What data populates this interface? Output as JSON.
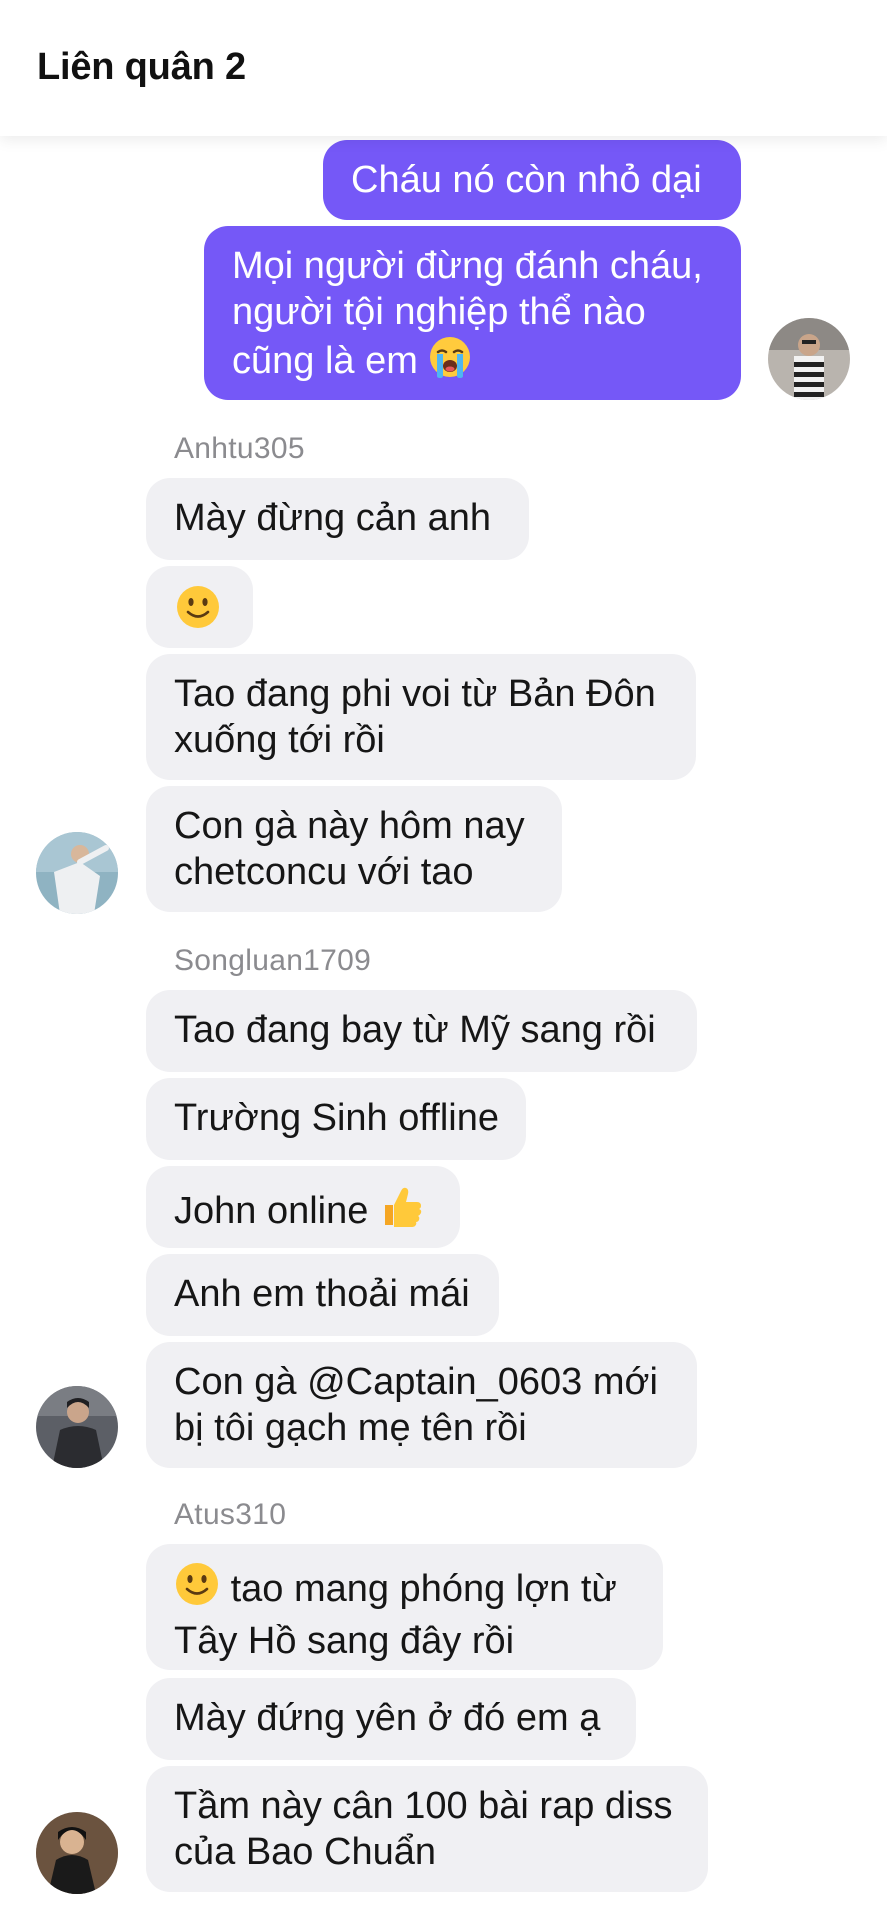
{
  "header": {
    "title": "Liên quân 2"
  },
  "messages": {
    "out_1": "Cháu nó còn nhỏ dại",
    "out_2_line1": "Mọi người đừng đánh cháu,",
    "out_2_line2": "người tội nghiệp thể nào",
    "out_2_line3": "cũng là em",
    "anhtu": {
      "sender": "Anhtu305",
      "m1": "Mày đừng cản anh",
      "m3_line1": "Tao đang phi voi từ Bản Đôn",
      "m3_line2": "xuống tới rồi",
      "m4_line1": "Con gà này hôm nay",
      "m4_line2": "chetconcu với tao"
    },
    "songluan": {
      "sender": "Songluan1709",
      "m1": "Tao đang bay từ Mỹ sang rồi",
      "m2": "Trường Sinh offline",
      "m3": "John online",
      "m4": "Anh em thoải mái",
      "m5_line1": "Con gà @Captain_0603 mới",
      "m5_line2": "bị tôi gạch mẹ tên rồi"
    },
    "atus": {
      "sender": "Atus310",
      "m1_line1": "tao mang phóng lợn từ",
      "m1_line2": "Tây Hồ sang đây rồi",
      "m2": "Mày đứng yên ở đó em ạ",
      "m3_line1": "Tầm này cân 100 bài rap diss",
      "m3_line2": "của Bao Chuẩn"
    }
  },
  "icons": {
    "crying": "loudly-crying-face-emoji",
    "smile": "slightly-smiling-face-emoji",
    "thumbs": "thumbs-up-emoji"
  },
  "colors": {
    "outgoing_bubble": "#7558f7",
    "incoming_bubble": "#f0f0f3",
    "sender_name": "#8b8b8f"
  }
}
